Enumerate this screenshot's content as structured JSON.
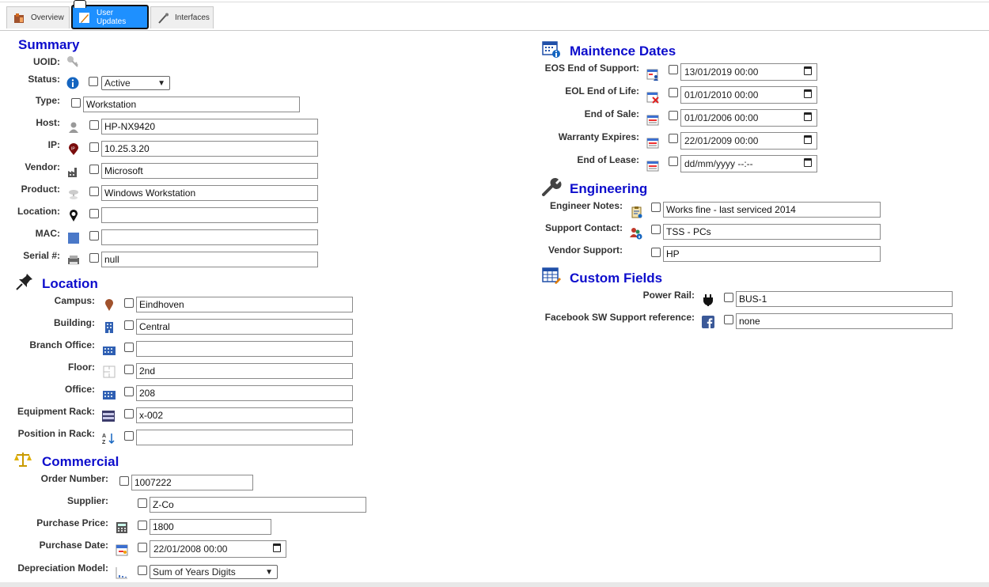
{
  "tabs": {
    "overview": "Overview",
    "user_updates": "User Updates",
    "interfaces": "Interfaces"
  },
  "summary": {
    "title": "Summary",
    "uoid_label": "UOID:",
    "status_label": "Status:",
    "status_value": "Active",
    "type_label": "Type:",
    "type_value": "Workstation",
    "host_label": "Host:",
    "host_value": "HP-NX9420",
    "ip_label": "IP:",
    "ip_value": "10.25.3.20",
    "vendor_label": "Vendor:",
    "vendor_value": "Microsoft",
    "product_label": "Product:",
    "product_value": "Windows Workstation",
    "location_label": "Location:",
    "location_value": "",
    "mac_label": "MAC:",
    "mac_value": "",
    "serial_label": "Serial #:",
    "serial_value": "null"
  },
  "location": {
    "title": "Location",
    "campus_label": "Campus:",
    "campus_value": "Eindhoven",
    "building_label": "Building:",
    "building_value": "Central",
    "branch_label": "Branch Office:",
    "branch_value": "",
    "floor_label": "Floor:",
    "floor_value": "2nd",
    "office_label": "Office:",
    "office_value": "208",
    "rack_label": "Equipment Rack:",
    "rack_value": "x-002",
    "position_label": "Position in Rack:",
    "position_value": ""
  },
  "commercial": {
    "title": "Commercial",
    "order_label": "Order Number:",
    "order_value": "1007222",
    "supplier_label": "Supplier:",
    "supplier_value": "Z-Co",
    "price_label": "Purchase Price:",
    "price_value": "1800",
    "pdate_label": "Purchase Date:",
    "pdate_value": "22/01/2008 00:00",
    "depr_label": "Depreciation Model:",
    "depr_value": "Sum of Years Digits"
  },
  "maintenance": {
    "title": "Maintence Dates",
    "eos_label": "EOS End of Support:",
    "eos_value": "13/01/2019 00:00",
    "eol_label": "EOL End of Life:",
    "eol_value": "01/01/2010 00:00",
    "sale_label": "End of Sale:",
    "sale_value": "01/01/2006 00:00",
    "warranty_label": "Warranty Expires:",
    "warranty_value": "22/01/2009 00:00",
    "lease_label": "End of Lease:",
    "lease_value": "dd/mm/yyyy --:--"
  },
  "engineering": {
    "title": "Engineering",
    "notes_label": "Engineer Notes:",
    "notes_value": "Works fine - last serviced 2014",
    "contact_label": "Support Contact:",
    "contact_value": "TSS - PCs",
    "vendor_support_label": "Vendor Support:",
    "vendor_support_value": "HP"
  },
  "custom": {
    "title": "Custom Fields",
    "power_label": "Power Rail:",
    "power_value": "BUS-1",
    "fb_label": "Facebook SW Support reference:",
    "fb_value": "none"
  },
  "colors": {
    "heading": "#0d0dcc",
    "tab_active": "#1e90ff"
  }
}
